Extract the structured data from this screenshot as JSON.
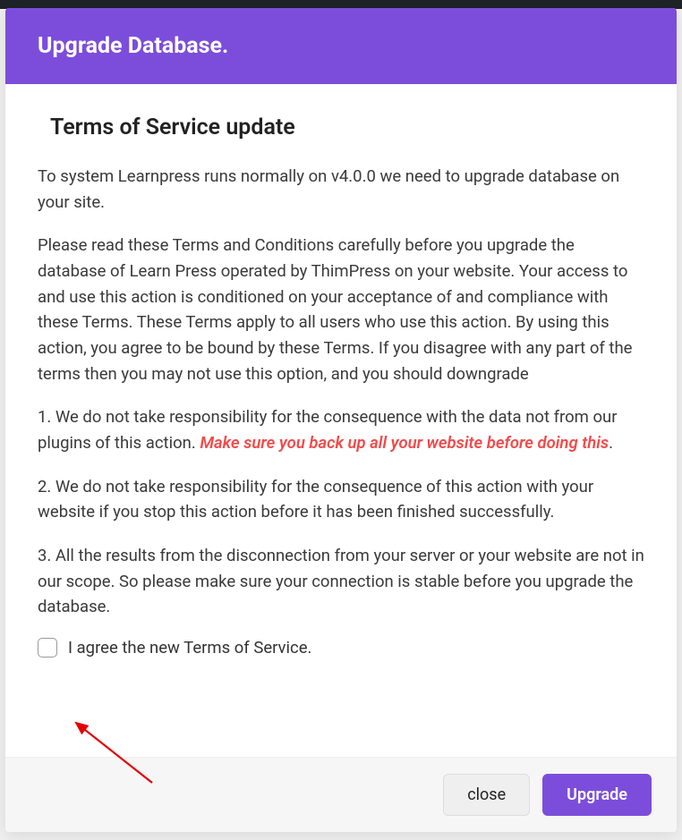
{
  "modal": {
    "title": "Upgrade Database.",
    "body_title": "Terms of Service update",
    "p1": "To system Learnpress runs normally on v4.0.0 we need to upgrade database on your site.",
    "p2": "Please read these Terms and Conditions carefully before you upgrade the database of Learn Press operated by ThimPress on your website. Your access to and use this action is conditioned on your acceptance of and compliance with these Terms. These Terms apply to all users who use this action. By using this action, you agree to be bound by these Terms. If you disagree with any part of the terms then you may not use this option, and you should downgrade",
    "p3_lead": "1. We do not take responsibility for the consequence with the data not from our plugins of this action. ",
    "p3_warning": "Make sure you back up all your website before doing this",
    "p3_tail": ".",
    "p4": "2. We do not take responsibility for the consequence of this action with your website if you stop this action before it has been finished successfully.",
    "p5": "3. All the results from the disconnection from your server or your website are not in our scope. So please make sure your connection is stable before you upgrade the database.",
    "agree_label": "I agree the new Terms of Service.",
    "agree_checked": false
  },
  "footer": {
    "close_label": "close",
    "upgrade_label": "Upgrade"
  },
  "colors": {
    "accent": "#7c4ddb",
    "warning": "#f24a4a"
  }
}
